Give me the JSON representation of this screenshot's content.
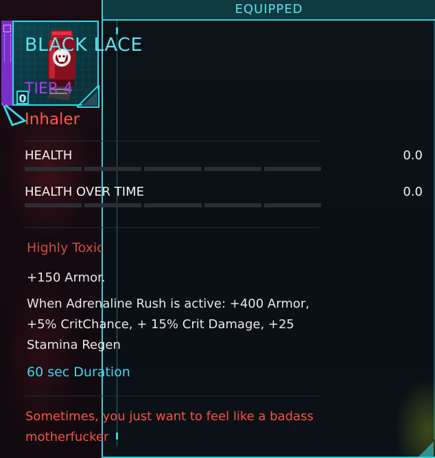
{
  "slot": {
    "count": "0",
    "icon": "inhaler-icon",
    "rarity_color": "#7a2ec8",
    "frame_color": "#33d9ea"
  },
  "tooltip": {
    "header": "EQUIPPED",
    "title": "BLACK LACE",
    "tier": "TIER 4",
    "type": "Inhaler",
    "stats": [
      {
        "label": "HEALTH",
        "value": "0.0",
        "fill": 0
      },
      {
        "label": "HEALTH OVER TIME",
        "value": "0.0",
        "fill": 0
      }
    ],
    "toxicity": "Highly Toxic",
    "effects": [
      "+150 Armor.",
      "When Adrenaline Rush is active: +400 Armor, +5% CritChance, + 15% Crit Damage, +25 Stamina Regen"
    ],
    "duration": "60 sec Duration",
    "flavor": "Sometimes, you just want to feel like a badass motherfucker"
  },
  "colors": {
    "accent": "#34d4e0",
    "title": "#5fe3ee",
    "tier": "#a640e8",
    "type": "#ff5a4e",
    "toxic": "#d24a44",
    "duration": "#3fd7f0",
    "flavor": "#ff4f45"
  }
}
